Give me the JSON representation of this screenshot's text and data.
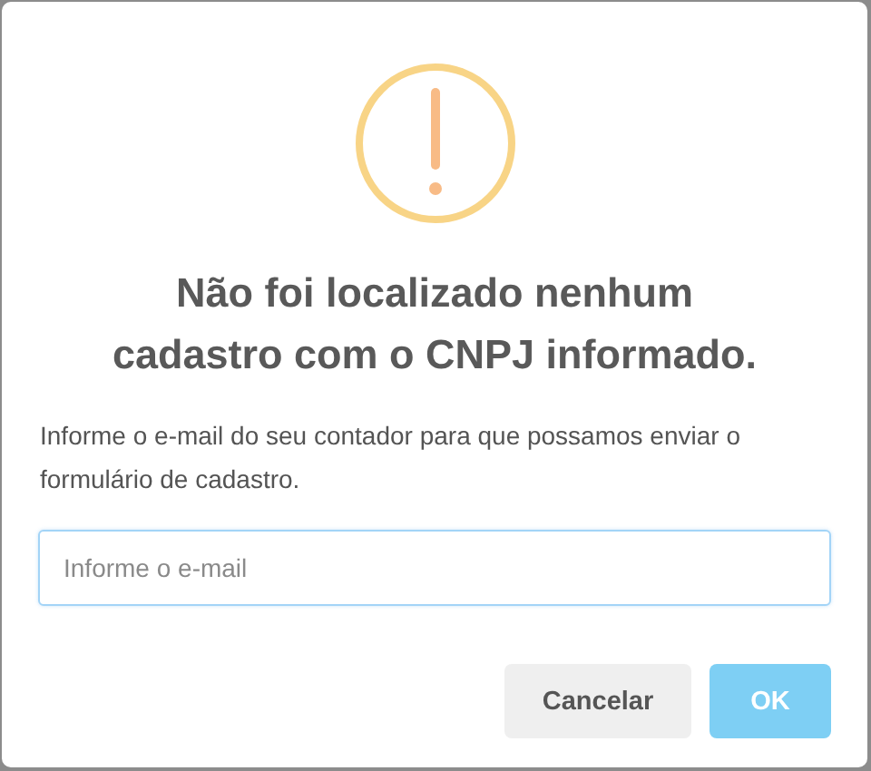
{
  "dialog": {
    "icon": {
      "kind": "warning"
    },
    "title": "Não foi localizado nenhum cadastro com o CNPJ informado.",
    "message": "Informe o e-mail do seu contador para que possamos enviar o formulário de cadastro.",
    "email_field": {
      "placeholder": "Informe o e-mail"
    },
    "buttons": [
      {
        "label": "Cancelar",
        "kind": "cancel",
        "disabled": false
      },
      {
        "label": "OK",
        "kind": "confirm",
        "disabled": true
      }
    ]
  }
}
